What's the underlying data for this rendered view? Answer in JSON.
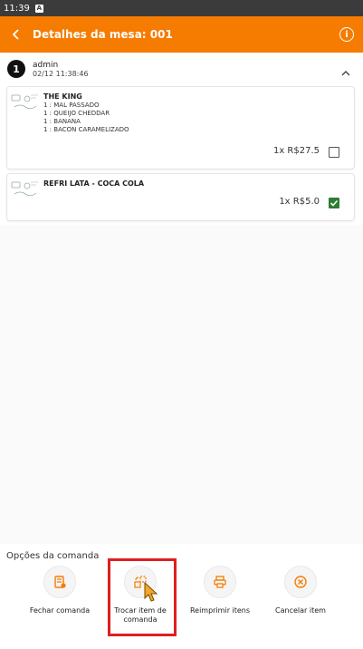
{
  "status_bar": {
    "time": "11:39",
    "indicator": "A"
  },
  "toolbar": {
    "title": "Detalhes da mesa: 001",
    "back_icon": "chevron-left-icon",
    "info_icon": "info-icon",
    "info_glyph": "i"
  },
  "order": {
    "badge": "1",
    "user": "admin",
    "timestamp": "02/12 11:38:46",
    "items": [
      {
        "name": "THE KING",
        "modifiers": [
          "1 : MAL PASSADO",
          "1 : QUEIJO CHEDDAR",
          "1 : BANANA",
          "1 : BACON CARAMELIZADO"
        ],
        "price_text": "1x R$27.5",
        "checked": false
      },
      {
        "name": "REFRI LATA - COCA COLA",
        "modifiers": [],
        "price_text": "1x R$5.0",
        "checked": true
      }
    ]
  },
  "options": {
    "title": "Opções da comanda",
    "buttons": [
      {
        "label": "Fechar comanda",
        "icon": "receipt-icon"
      },
      {
        "label": "Trocar item de comanda",
        "icon": "swap-item-icon"
      },
      {
        "label": "Reimprimir itens",
        "icon": "printer-icon"
      },
      {
        "label": "Cancelar item",
        "icon": "cancel-circle-icon"
      }
    ]
  },
  "colors": {
    "toolbar": "#f57c00",
    "accent_icon": "#f57c00",
    "check_green": "#2e7d32",
    "highlight": "#e01e1e"
  }
}
